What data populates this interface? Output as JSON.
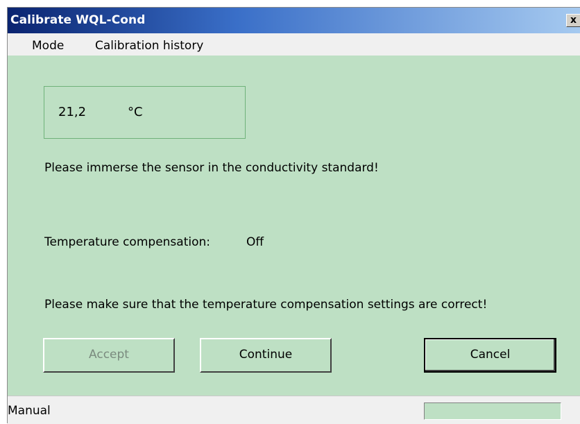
{
  "window": {
    "title": "Calibrate WQL-Cond",
    "close_label": "x"
  },
  "menu": {
    "items": [
      {
        "label": "Mode"
      },
      {
        "label": "Calibration history"
      }
    ]
  },
  "temperature": {
    "value": "21,2",
    "unit": "°C"
  },
  "instruction": "Please immerse the sensor in the conductivity standard!",
  "compensation": {
    "label": "Temperature compensation:",
    "value": "Off"
  },
  "note": "Please make sure that the temperature compensation settings are correct!",
  "buttons": {
    "accept": "Accept",
    "continue": "Continue",
    "cancel": "Cancel"
  },
  "status": {
    "mode_text": "Manual",
    "panel_text": ""
  },
  "colors": {
    "background": "#bee0c4",
    "titlebar_start": "#0a2470",
    "titlebar_end": "#a6caf0",
    "menubar": "#f0f0f0"
  }
}
